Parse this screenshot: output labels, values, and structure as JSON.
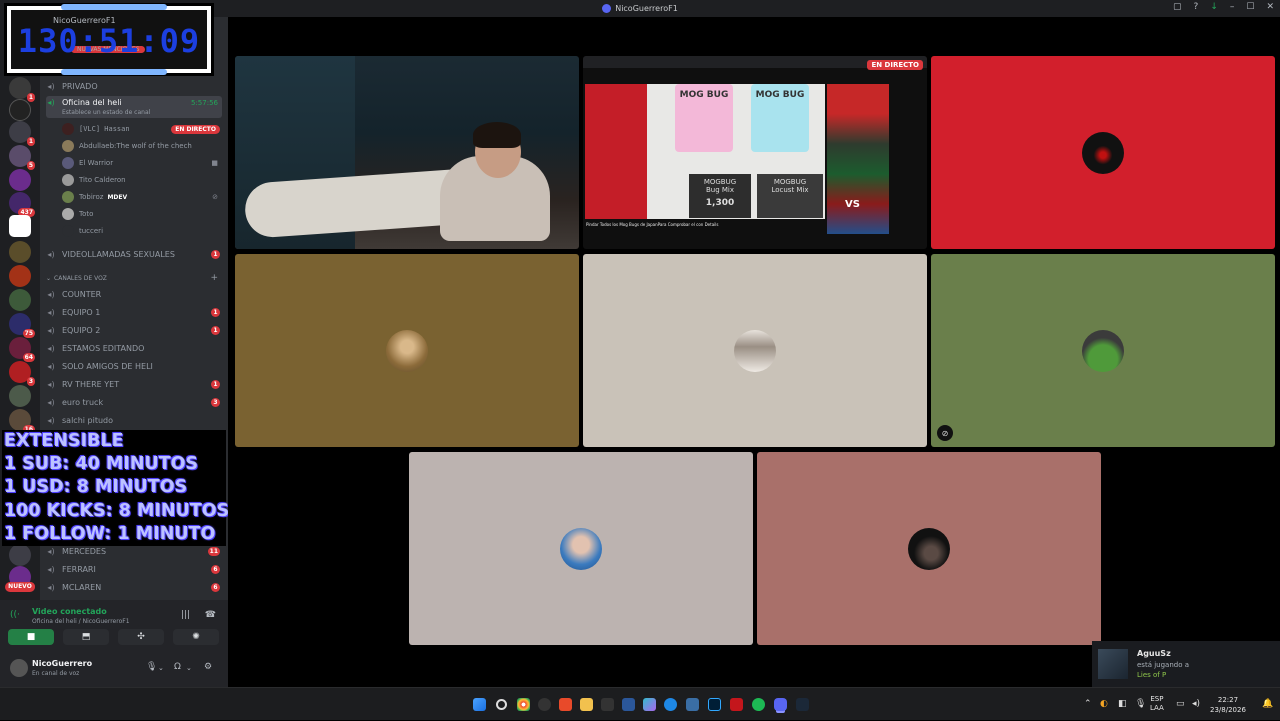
{
  "window": {
    "title": "NicoGuerreroF1",
    "controls": [
      "▢",
      "?",
      "↓",
      "–",
      "☐",
      "✕"
    ]
  },
  "timer": {
    "value": "130:51:09",
    "user": "NicoGuerreroF1",
    "mentions": "NUEVAS MENCIONES"
  },
  "guild_badges": [
    "1",
    "",
    "1",
    "5",
    "437",
    "",
    "",
    "",
    "",
    "75",
    "64",
    "3",
    "",
    "16",
    "",
    "11",
    "",
    "12",
    "NUEVO"
  ],
  "channels": [
    {
      "name": "PRIVADO",
      "badge": ""
    },
    {
      "name": "Oficina del heli",
      "status": "Establece un estado de canal",
      "time": "5:57:56"
    },
    {
      "name": "VIDEOLLAMADAS SEXUALES",
      "badge": "1"
    },
    {
      "name": "CANALES DE VOZ",
      "type": "category"
    },
    {
      "name": "COUNTER",
      "badge": ""
    },
    {
      "name": "EQUIPO 1",
      "badge": "1"
    },
    {
      "name": "EQUIPO 2",
      "badge": "1"
    },
    {
      "name": "ESTAMOS EDITANDO",
      "badge": ""
    },
    {
      "name": "SOLO AMIGOS DE HELI",
      "badge": ""
    },
    {
      "name": "RV THERE YET",
      "badge": "1"
    },
    {
      "name": "euro truck",
      "badge": "3"
    },
    {
      "name": "salchi pitudo",
      "badge": ""
    },
    {
      "name": "MERCEDES",
      "badge": "11"
    },
    {
      "name": "FERRARI",
      "badge": "6"
    },
    {
      "name": "MCLAREN",
      "badge": "6"
    }
  ],
  "voice_users": [
    {
      "name": "[VLC] Hassan",
      "live": "EN DIRECTO"
    },
    {
      "name": "Abdullaeb:The wolf of the chech"
    },
    {
      "name": "El Warrior"
    },
    {
      "name": "Tito Calderon"
    },
    {
      "name": "Tobiroz",
      "tag": "MDEV"
    },
    {
      "name": "Toto"
    },
    {
      "name": "tucceri"
    }
  ],
  "overlay": {
    "lines": [
      "EXTENSIBLE",
      "1 SUB: 40 MINUTOS",
      "1 USD: 8 MINUTOS",
      "100 KICKS: 8 MINUTOS",
      "1 FOLLOW: 1 MINUTO"
    ]
  },
  "voice_panel": {
    "status": "Video conectado",
    "location": "Oficina del heli / NicoGuerreroF1",
    "user_name": "NicoGuerrero",
    "user_status": "En canal de voz"
  },
  "tiles": {
    "screen_share_badge": "EN DIRECTO",
    "screen_share_title": "Pindar Todos los Mog Bugs de JapanPara Comprobar el con Details",
    "product_a": "MOG BUG",
    "product_b": "MOG BUG",
    "product_c": "MOGBUG",
    "product_d": "MOGBUG",
    "label_a": "Bug Mix",
    "label_b": "Locust Mix",
    "price": "1,300",
    "vs": "VS"
  },
  "toast": {
    "name": "AguuSz",
    "activity": "está jugando a",
    "game": "Lies of P"
  },
  "tray": {
    "lang_top": "ESP",
    "lang_bottom": "LAA",
    "time": "22:27",
    "date": "23/8/2026"
  },
  "colors": {
    "discord_dark": "#1e1f22",
    "sidebar": "#2b2d31",
    "green": "#23a55a",
    "red_badge": "#da373c",
    "tile_red": "#d21f2c",
    "tile_olive": "#7a6231",
    "tile_beige": "#c9c2b8",
    "tile_green": "#6a7f4b",
    "tile_gray": "#bcb3b0",
    "tile_rose": "#a9706a",
    "overlay_text": "#bcc2ff"
  }
}
